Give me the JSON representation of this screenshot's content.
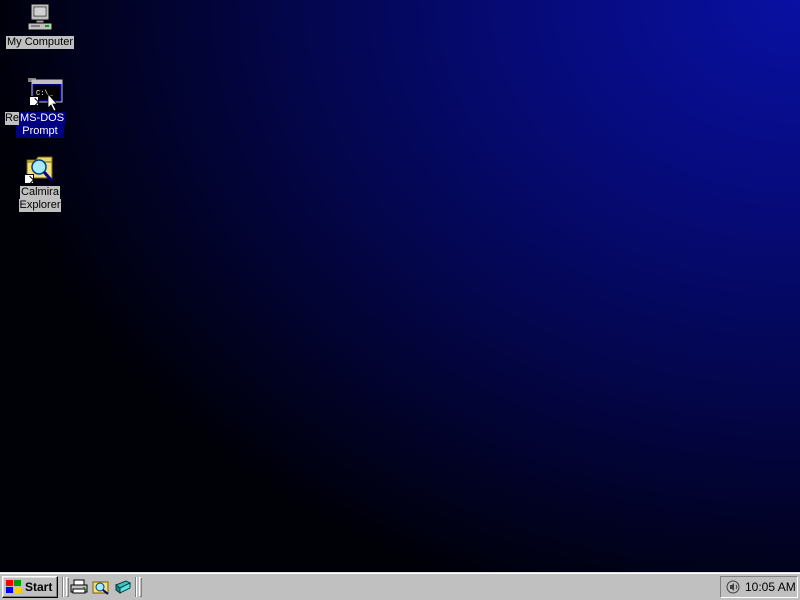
{
  "desktop": {
    "icons": [
      {
        "name": "my-computer",
        "label": "My Computer"
      },
      {
        "name": "ms-dos-prompt",
        "label": "MS-DOS Prompt",
        "line1": "MS-DOS",
        "line2": "Prompt",
        "hidden_prefix": "Re",
        "screen_text": "C:\\_"
      },
      {
        "name": "calmira-explorer",
        "label": "Calmira Explorer",
        "line1": "Calmira",
        "line2": "Explorer"
      }
    ]
  },
  "taskbar": {
    "start_label": "Start",
    "quick_launch": [
      "printer-icon",
      "explorer-icon",
      "desktop-icon"
    ],
    "clock": "10:05 AM"
  },
  "colors": {
    "desktop_bright": "#0a12b4",
    "desktop_dark": "#000008",
    "taskbar": "#c0c0c0",
    "selection": "#000080"
  }
}
